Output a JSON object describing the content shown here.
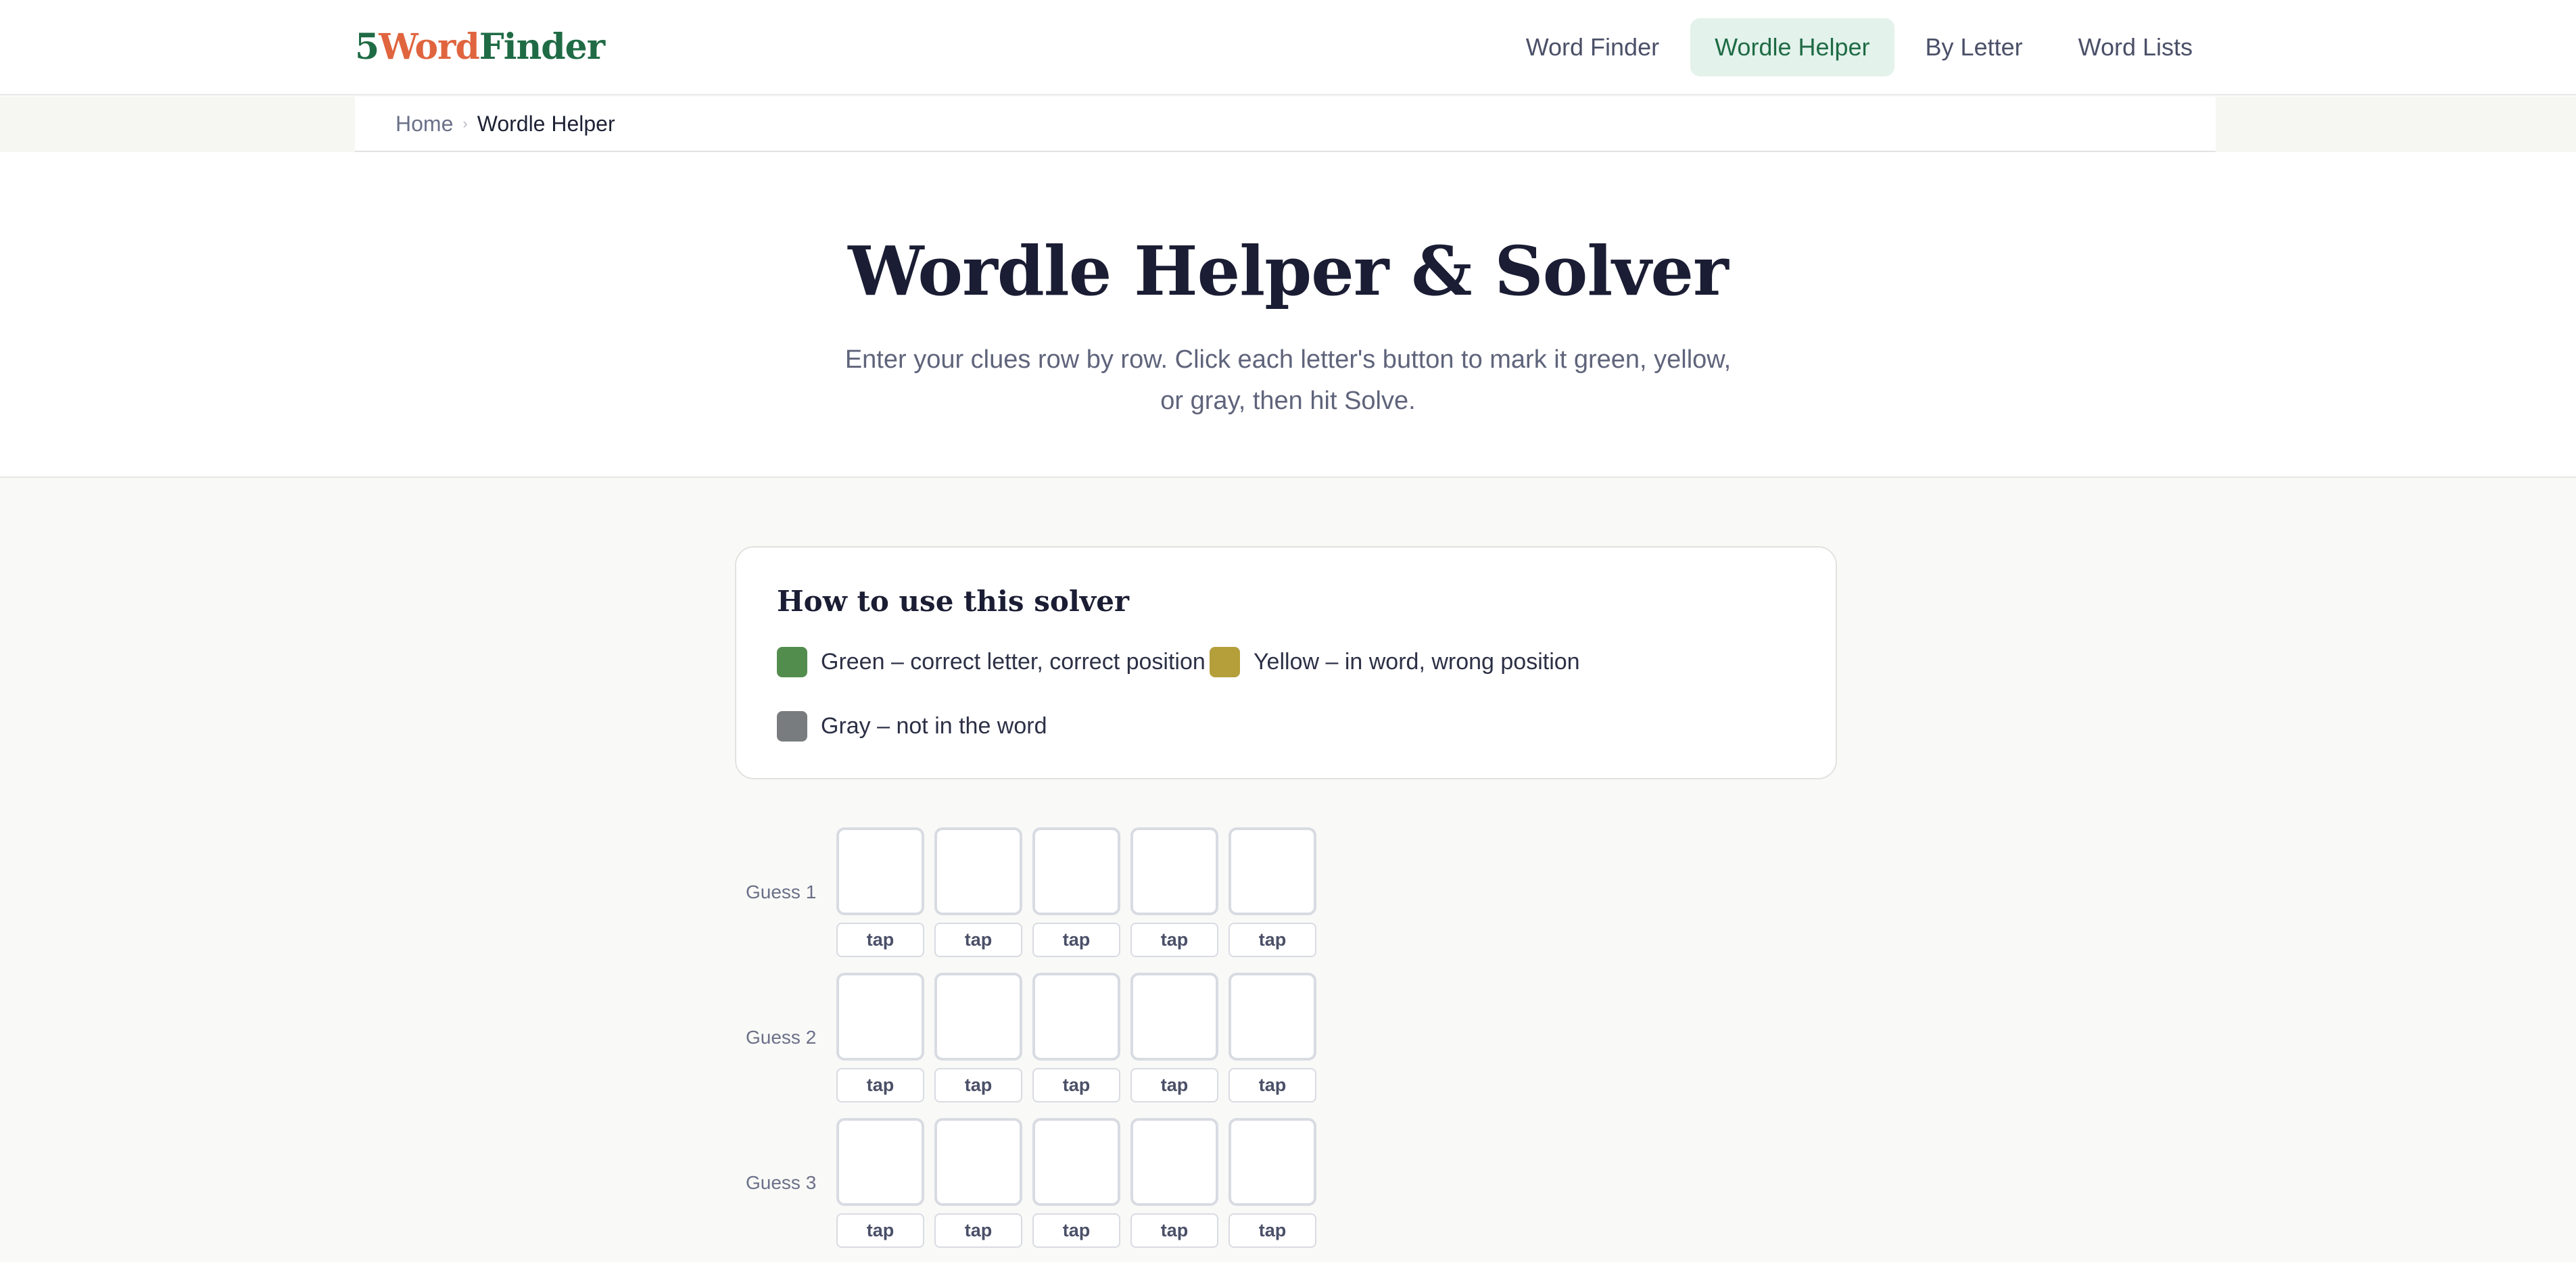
{
  "logo": {
    "part1": "5",
    "part2": "Word",
    "part3": "Finder"
  },
  "nav": [
    {
      "label": "Word Finder"
    },
    {
      "label": "Wordle Helper",
      "active": true
    },
    {
      "label": "By Letter"
    },
    {
      "label": "Word Lists"
    }
  ],
  "breadcrumb": {
    "home": "Home",
    "separator": "›",
    "current": "Wordle Helper"
  },
  "hero": {
    "title": "Wordle Helper & Solver",
    "subtitle": "Enter your clues row by row. Click each letter's button to mark it green, yellow, or gray, then hit Solve."
  },
  "howto": {
    "title": "How to use this solver",
    "legend": [
      {
        "label": "Green – correct letter, correct position",
        "color": "#538d4e"
      },
      {
        "label": "Yellow – in word, wrong position",
        "color": "#b59f3b"
      },
      {
        "label": "Gray – not in the word",
        "color": "#787c7e"
      }
    ]
  },
  "guesses": [
    {
      "label": "Guess 1",
      "tiles": [
        "",
        "",
        "",
        "",
        ""
      ],
      "buttons": [
        "tap",
        "tap",
        "tap",
        "tap",
        "tap"
      ]
    },
    {
      "label": "Guess 2",
      "tiles": [
        "",
        "",
        "",
        "",
        ""
      ],
      "buttons": [
        "tap",
        "tap",
        "tap",
        "tap",
        "tap"
      ]
    },
    {
      "label": "Guess 3",
      "tiles": [
        "",
        "",
        "",
        "",
        ""
      ],
      "buttons": [
        "tap",
        "tap",
        "tap",
        "tap",
        "tap"
      ]
    }
  ]
}
